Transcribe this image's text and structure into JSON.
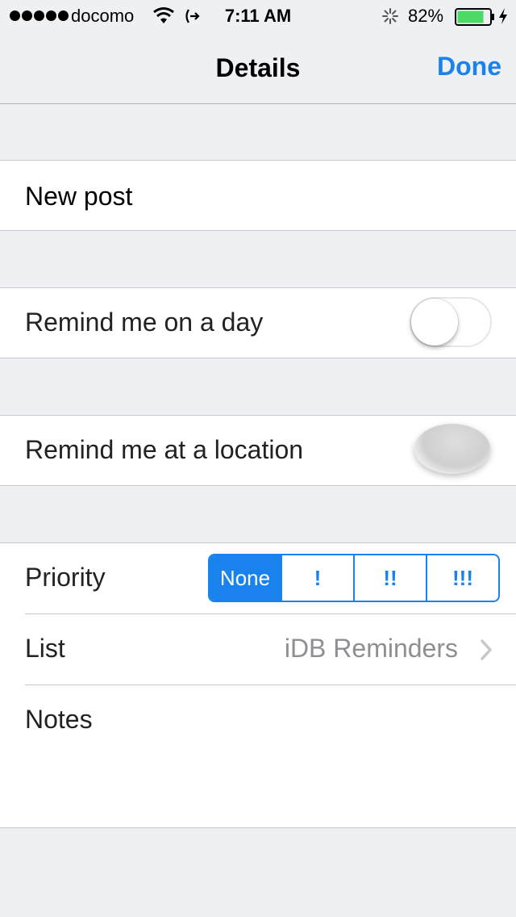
{
  "status_bar": {
    "carrier": "docomo",
    "time": "7:11 AM",
    "battery": "82%"
  },
  "nav": {
    "title": "Details",
    "done_label": "Done"
  },
  "title_cell": {
    "value": "New post"
  },
  "remind_day": {
    "label": "Remind me on a day",
    "toggle": "off"
  },
  "remind_location": {
    "label": "Remind me at a location"
  },
  "priority": {
    "label": "Priority",
    "options": [
      "None",
      "!",
      "!!",
      "!!!"
    ],
    "selected": "None"
  },
  "list": {
    "label": "List",
    "value": "iDB Reminders"
  },
  "notes": {
    "label": "Notes"
  },
  "colors": {
    "accent": "#1a82ec",
    "background": "#eff0f4",
    "battery_fill": "#4cd964"
  }
}
